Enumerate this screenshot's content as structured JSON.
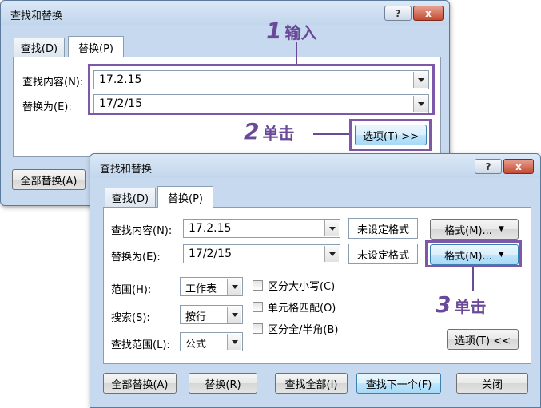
{
  "back_dialog": {
    "title": "查找和替换",
    "help_label": "?",
    "close_label": "x",
    "tabs": [
      {
        "label": "查找(D)"
      },
      {
        "label": "替换(P)"
      }
    ],
    "find_label": "查找内容(N):",
    "find_value": "17.2.15",
    "replace_label": "替换为(E):",
    "replace_value": "17/2/15",
    "options_button": "选项(T) >>",
    "replace_all_button": "全部替换(A)"
  },
  "front_dialog": {
    "title": "查找和替换",
    "help_label": "?",
    "close_label": "x",
    "tabs": [
      {
        "label": "查找(D)"
      },
      {
        "label": "替换(P)"
      }
    ],
    "find_label": "查找内容(N):",
    "find_value": "17.2.15",
    "find_format_status": "未设定格式",
    "find_format_button": "格式(M)...",
    "replace_label": "替换为(E):",
    "replace_value": "17/2/15",
    "replace_format_status": "未设定格式",
    "replace_format_button": "格式(M)...",
    "within_label": "范围(H):",
    "within_value": "工作表",
    "search_label": "搜索(S):",
    "search_value": "按行",
    "lookin_label": "查找范围(L):",
    "lookin_value": "公式",
    "checkboxes": [
      {
        "label": "区分大小写(C)",
        "checked": false
      },
      {
        "label": "单元格匹配(O)",
        "checked": false
      },
      {
        "label": "区分全/半角(B)",
        "checked": false
      }
    ],
    "options_button": "选项(T) <<",
    "buttons": {
      "replace_all": "全部替换(A)",
      "replace": "替换(R)",
      "find_all": "查找全部(I)",
      "find_next": "查找下一个(F)",
      "close": "关闭"
    }
  },
  "annotations": [
    {
      "num": "1",
      "text": "输入"
    },
    {
      "num": "2",
      "text": "单击"
    },
    {
      "num": "3",
      "text": "单击"
    }
  ],
  "colors": {
    "annotation": "#6a4a98",
    "dialog_bg": "#c7d9ee",
    "close_button": "#c34a34"
  }
}
